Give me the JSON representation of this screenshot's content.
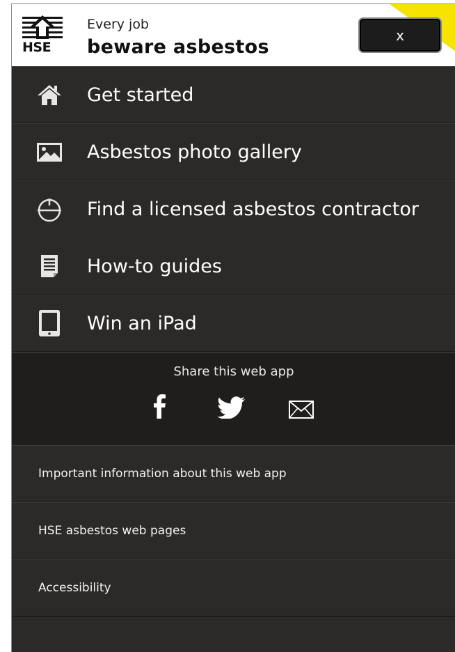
{
  "header": {
    "logo_text": "HSE",
    "subtitle": "Every job",
    "title": "beware asbestos",
    "close_label": "x"
  },
  "menu": {
    "items": [
      {
        "label": "Get started",
        "icon": "home-icon"
      },
      {
        "label": "Asbestos photo gallery",
        "icon": "photo-icon"
      },
      {
        "label": "Find a licensed asbestos contractor",
        "icon": "crosshair-icon"
      },
      {
        "label": "How-to guides",
        "icon": "document-icon"
      },
      {
        "label": "Win an iPad",
        "icon": "tablet-icon"
      }
    ]
  },
  "share": {
    "title": "Share this web app",
    "icons": [
      "facebook-icon",
      "twitter-icon",
      "email-icon"
    ]
  },
  "links": [
    {
      "label": "Important information about this web app"
    },
    {
      "label": "HSE asbestos web pages"
    },
    {
      "label": "Accessibility"
    }
  ],
  "colors": {
    "panel": "#2c2a28",
    "share_bg": "#1f1e1d",
    "accent": "#f4e400",
    "text": "#ffffff"
  }
}
